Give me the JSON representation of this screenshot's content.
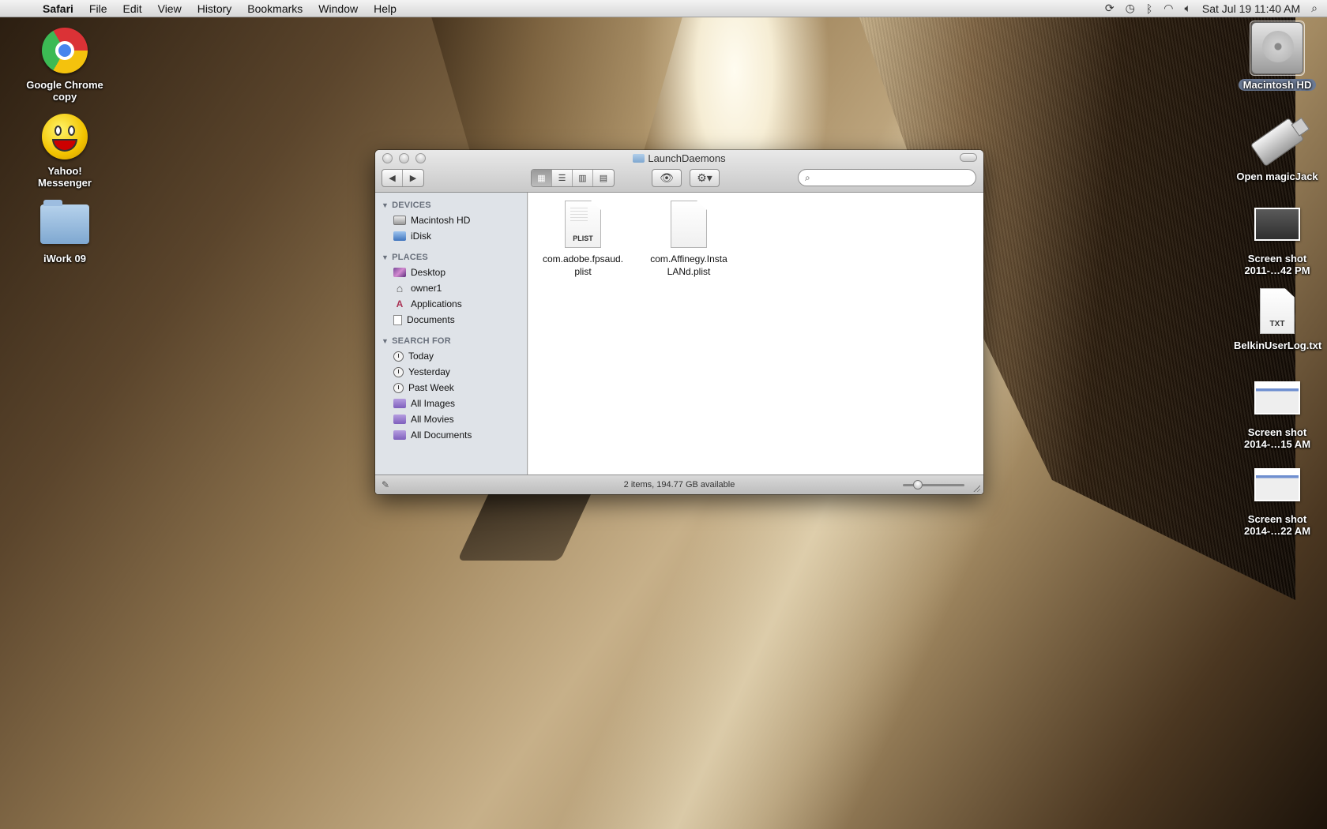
{
  "menubar": {
    "app": "Safari",
    "items": [
      "File",
      "Edit",
      "View",
      "History",
      "Bookmarks",
      "Window",
      "Help"
    ],
    "clock": "Sat Jul 19  11:40 AM"
  },
  "desktop": {
    "left_icons": [
      {
        "label": "Google Chrome copy",
        "icon": "chrome-icon"
      },
      {
        "label": "Yahoo! Messenger",
        "icon": "yahoo-icon"
      },
      {
        "label": "iWork 09",
        "icon": "folder-icon"
      }
    ],
    "right_icons": [
      {
        "label": "Macintosh HD",
        "icon": "hard-drive-icon"
      },
      {
        "label": "Open magicJack",
        "icon": "usb-icon"
      },
      {
        "label": "Screen shot 2011-…42 PM",
        "icon": "screenshot-thumb-icon"
      },
      {
        "label": "BelkinUserLog.txt",
        "icon": "txt-doc-icon",
        "badge": "TXT"
      },
      {
        "label": "Screen shot 2014-…15 AM",
        "icon": "screenshot-thumb-icon"
      },
      {
        "label": "Screen shot 2014-…22 AM",
        "icon": "screenshot-thumb-icon"
      }
    ]
  },
  "finder": {
    "title": "LaunchDaemons",
    "search_placeholder": "",
    "sidebar": {
      "devices_header": "DEVICES",
      "devices": [
        "Macintosh HD",
        "iDisk"
      ],
      "places_header": "PLACES",
      "places": [
        "Desktop",
        "owner1",
        "Applications",
        "Documents"
      ],
      "search_header": "SEARCH FOR",
      "search_for": [
        "Today",
        "Yesterday",
        "Past Week",
        "All Images",
        "All Movies",
        "All Documents"
      ]
    },
    "files": [
      {
        "name_line1": "com.adobe.fpsaud.",
        "name_line2": "plist",
        "badge": "PLIST"
      },
      {
        "name_line1": "com.Affinegy.Insta",
        "name_line2": "LANd.plist",
        "badge": ""
      }
    ],
    "status": "2 items, 194.77 GB available"
  }
}
